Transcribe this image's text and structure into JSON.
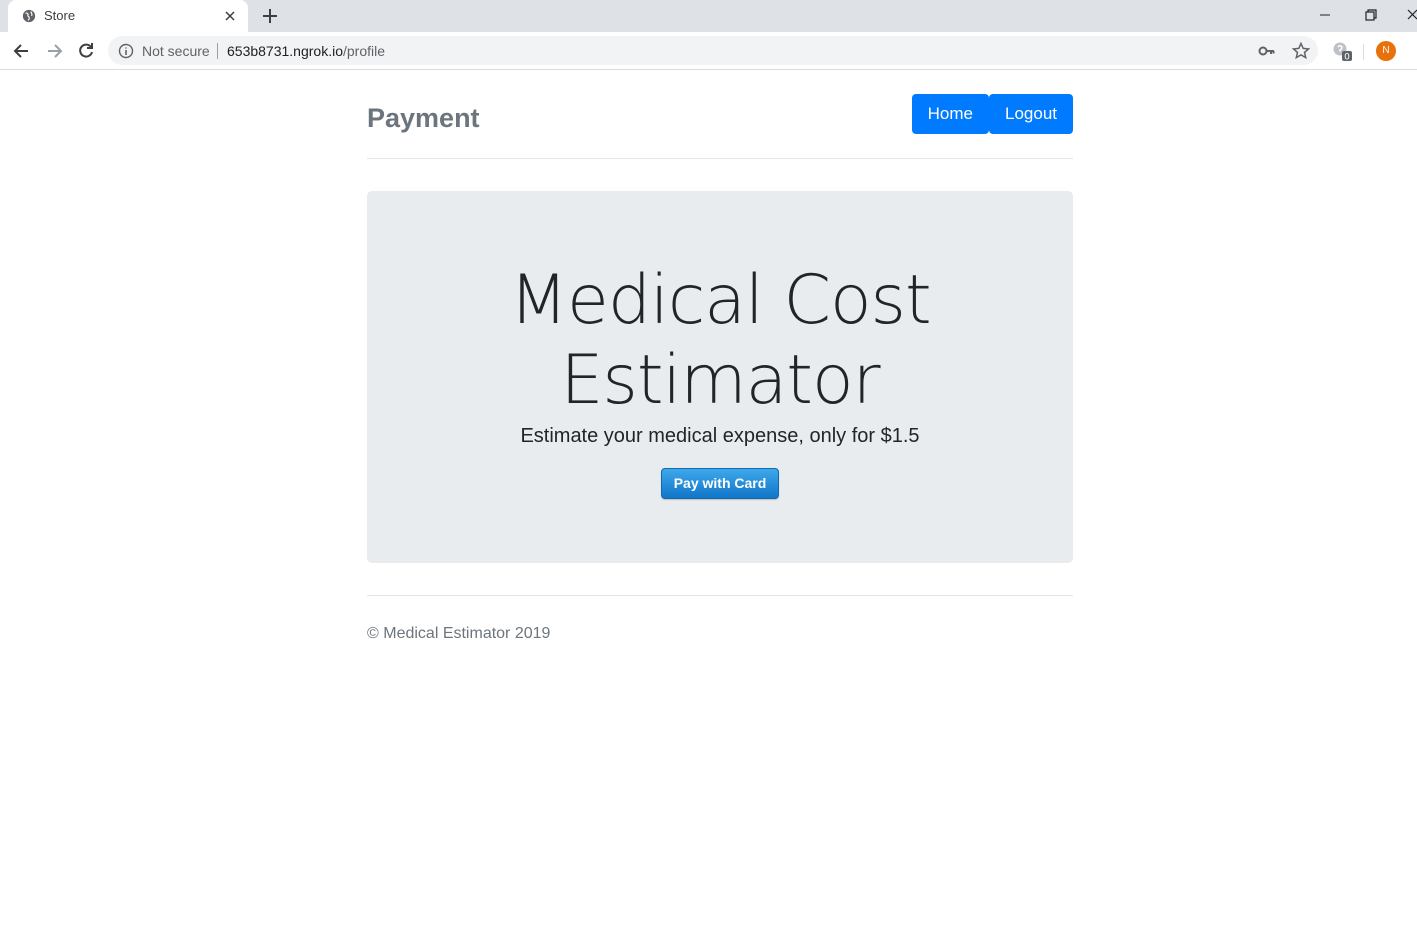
{
  "browser": {
    "tab_title": "Store",
    "security_label": "Not secure",
    "url_host": "653b8731.ngrok.io",
    "url_path": "/profile",
    "extension_badge": "0",
    "profile_initial": "N"
  },
  "header": {
    "brand": "Payment",
    "nav": [
      "Home",
      "Logout"
    ]
  },
  "jumbotron": {
    "title_line1": "Medical Cost",
    "title_line2": "Estimator",
    "lead_text": "Estimate your medical expense, only for ",
    "price": "$1.5",
    "pay_button": "Pay with Card"
  },
  "footer": {
    "text": "© Medical Estimator 2019"
  },
  "colors": {
    "primary": "#007bff",
    "jumbotron_bg": "#e9ecef",
    "muted": "#6c757d",
    "pay_button": "#1b82d1"
  }
}
